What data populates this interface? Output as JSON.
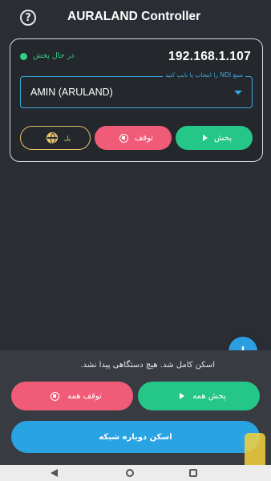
{
  "header": {
    "help_icon": "?",
    "title": "AURALAND Controller"
  },
  "device": {
    "status": "در حال پخش",
    "ip": "192.168.1.107",
    "source_label": "منبع NDI را انتخاب یا تایپ کنید",
    "source_value": "AMIN (ARULAND)",
    "play_label": "پخش",
    "stop_label": "توقف",
    "ndi_label": "پل"
  },
  "scan": {
    "message": "اسکن کامل شد. هیچ دستگاهی پیدا نشد.",
    "play_all_label": "پخش همه",
    "stop_all_label": "توقف همه",
    "rescan_label": "اسکن دوباره شبکه"
  },
  "fab": {
    "label": "+"
  },
  "colors": {
    "background": "#2a2d33",
    "accent_blue": "#2a9ee0",
    "play_green": "#25c789",
    "stop_red": "#f05c77",
    "ndi_gold": "#e6c36a"
  }
}
